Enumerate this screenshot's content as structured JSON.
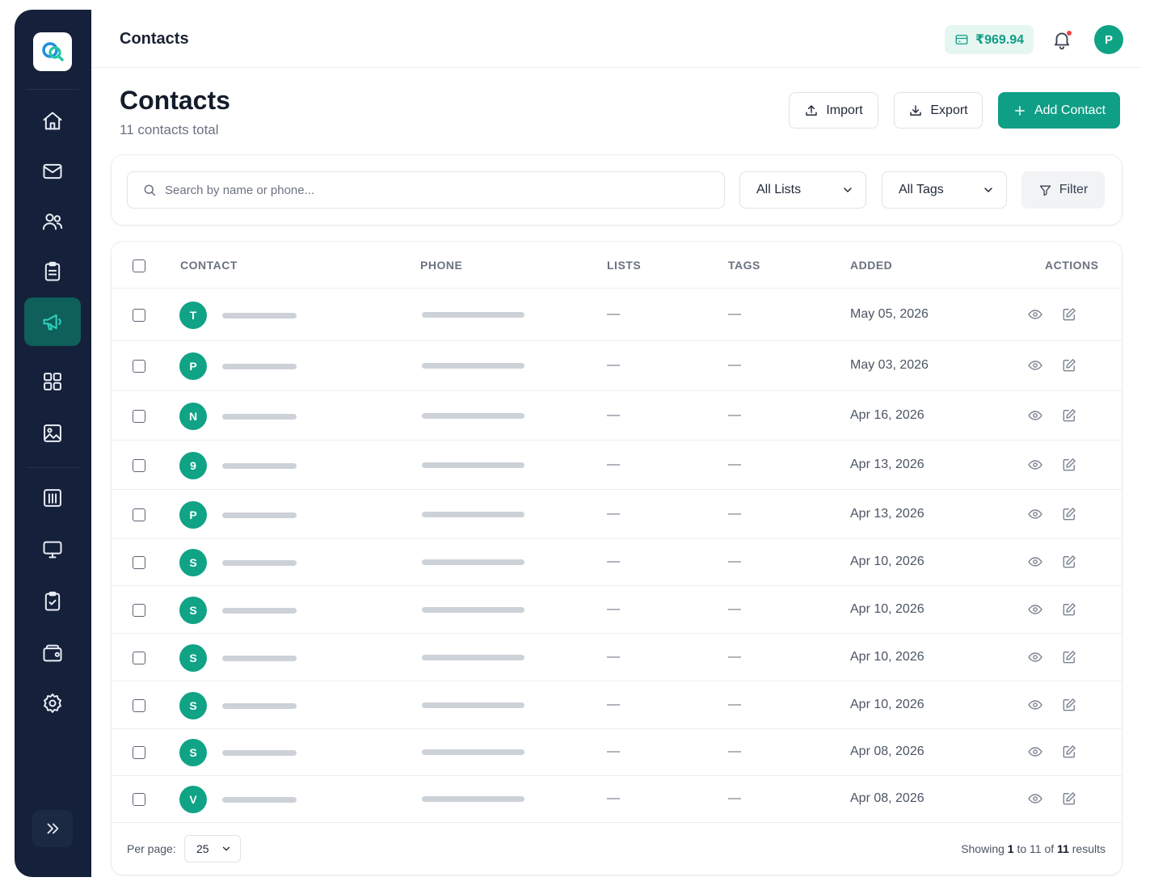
{
  "topbar": {
    "title": "Contacts",
    "balance": "₹969.94",
    "avatar_initial": "P"
  },
  "page": {
    "title": "Contacts",
    "subtitle": "11 contacts total"
  },
  "actions": {
    "import_label": "Import",
    "export_label": "Export",
    "add_label": "Add Contact"
  },
  "filters": {
    "search_placeholder": "Search by name or phone...",
    "lists_selected": "All Lists",
    "tags_selected": "All Tags",
    "filter_label": "Filter"
  },
  "table": {
    "columns": {
      "contact": "CONTACT",
      "phone": "PHONE",
      "lists": "LISTS",
      "tags": "TAGS",
      "added": "ADDED",
      "actions": "ACTIONS"
    },
    "rows": [
      {
        "initial": "T",
        "lists": "—",
        "tags": "—",
        "added": "May 05, 2026"
      },
      {
        "initial": "P",
        "lists": "—",
        "tags": "—",
        "added": "May 03, 2026"
      },
      {
        "initial": "N",
        "lists": "—",
        "tags": "—",
        "added": "Apr 16, 2026"
      },
      {
        "initial": "9",
        "lists": "—",
        "tags": "—",
        "added": "Apr 13, 2026"
      },
      {
        "initial": "P",
        "lists": "—",
        "tags": "—",
        "added": "Apr 13, 2026"
      },
      {
        "initial": "S",
        "lists": "—",
        "tags": "—",
        "added": "Apr 10, 2026"
      },
      {
        "initial": "S",
        "lists": "—",
        "tags": "—",
        "added": "Apr 10, 2026"
      },
      {
        "initial": "S",
        "lists": "—",
        "tags": "—",
        "added": "Apr 10, 2026"
      },
      {
        "initial": "S",
        "lists": "—",
        "tags": "—",
        "added": "Apr 10, 2026"
      },
      {
        "initial": "S",
        "lists": "—",
        "tags": "—",
        "added": "Apr 08, 2026"
      },
      {
        "initial": "V",
        "lists": "—",
        "tags": "—",
        "added": "Apr 08, 2026"
      }
    ]
  },
  "pagination": {
    "per_page_label": "Per page:",
    "per_page_value": "25",
    "showing_prefix": "Showing",
    "from": "1",
    "to_word": "to",
    "to": "11",
    "of_word": "of",
    "total": "11",
    "results_word": "results"
  },
  "sidebar": {
    "items": [
      "home-icon",
      "mail-icon",
      "users-icon",
      "clipboard-icon",
      "megaphone-icon",
      "grid-icon",
      "image-icon",
      "chart-icon",
      "monitor-icon",
      "task-icon",
      "wallet-icon",
      "settings-icon"
    ],
    "active": "megaphone-icon"
  },
  "colors": {
    "accent": "#0f9e86",
    "sidebar": "#15213a",
    "active_nav": "#0f5f5b"
  }
}
